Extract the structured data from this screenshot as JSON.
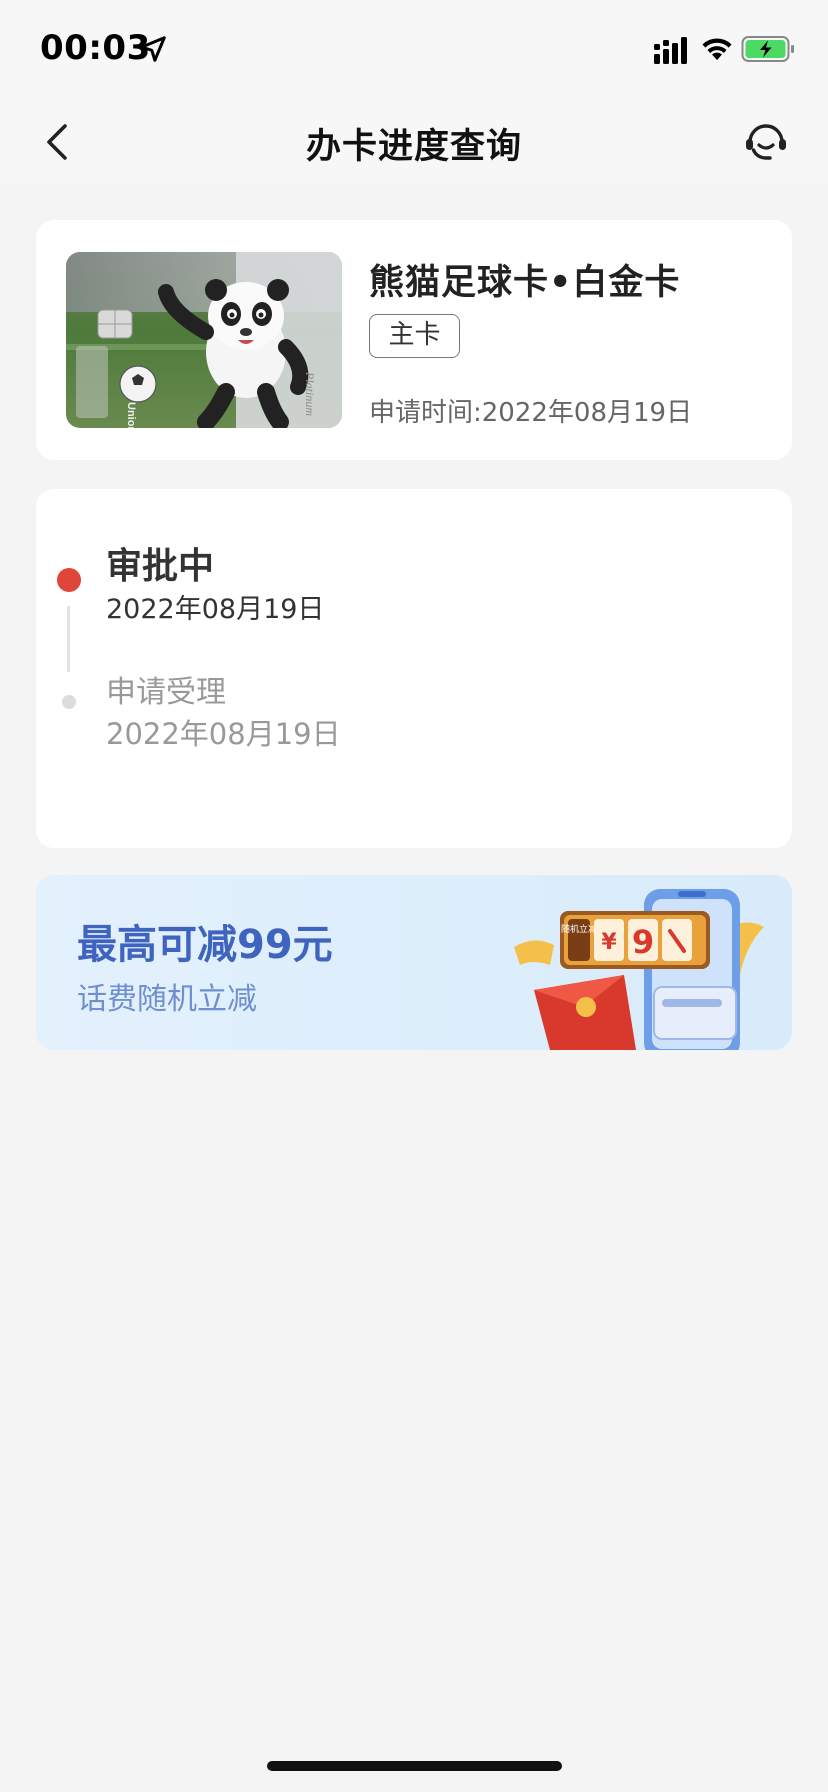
{
  "status_bar": {
    "time": "00:03",
    "icons": [
      "location-arrow-icon",
      "cellular-signal-icon",
      "wifi-icon",
      "battery-charging-icon"
    ],
    "battery_color": "#4cd964"
  },
  "nav": {
    "title": "办卡进度查询",
    "icons": [
      "back-chevron-icon",
      "customer-service-headset-icon"
    ]
  },
  "card": {
    "name": "熊猫足球卡•白金卡",
    "tag": "主卡",
    "apply_time": "申请时间:2022年08月19日",
    "image": {
      "icon": "panda-football-card-image",
      "brand_text": "UnionPay 银联",
      "card_text": "Platinum"
    }
  },
  "progress": {
    "steps": [
      {
        "title": "审批中",
        "date": "2022年08月19日",
        "active": true
      },
      {
        "title": "申请受理",
        "date": "2022年08月19日",
        "active": false
      }
    ],
    "active_color": "#e0453a"
  },
  "banner": {
    "title": "最高可减99元",
    "subtitle": "话费随机立减",
    "art_text": {
      "side_label": "随机立减",
      "currency": "¥",
      "digit": "9"
    },
    "title_color": "#3f64c0"
  }
}
